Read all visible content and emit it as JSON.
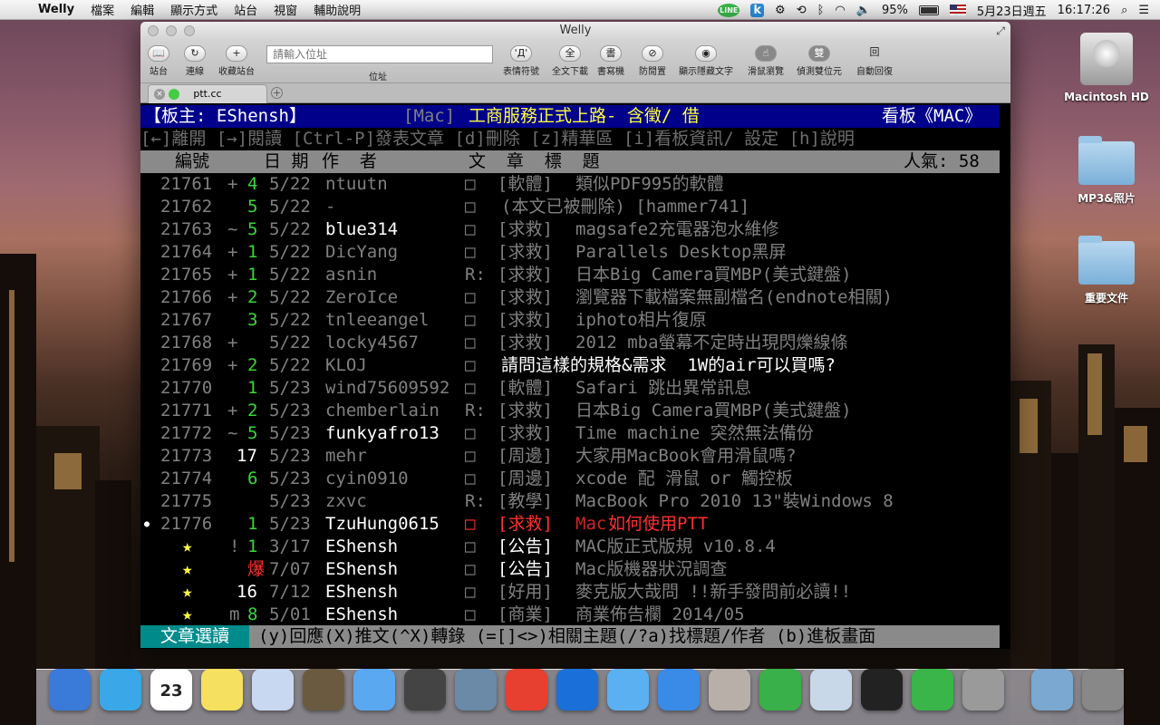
{
  "menubar": {
    "app": "Welly",
    "items": [
      "檔案",
      "編輯",
      "顯示方式",
      "站台",
      "視窗",
      "輔助說明"
    ],
    "battery": "95%",
    "date": "5月23日週五",
    "time": "16:17:26"
  },
  "desktop": {
    "icons": [
      "Macintosh HD",
      "MP3&照片",
      "重要文件"
    ]
  },
  "window": {
    "title": "Welly",
    "tab": "ptt.cc",
    "url_placeholder": "請輸入位址",
    "url_label": "位址",
    "toolbar": {
      "left": [
        {
          "glyph": "📖",
          "label": "站台"
        },
        {
          "glyph": "↻",
          "label": "連線"
        },
        {
          "glyph": "+",
          "label": "收藏站台"
        }
      ],
      "right": [
        {
          "glyph": "'Д'",
          "label": "表情符號"
        },
        {
          "glyph": "全",
          "label": "全文下載"
        },
        {
          "glyph": "書",
          "label": "書寫機"
        },
        {
          "glyph": "⊘",
          "label": "防閒置"
        },
        {
          "glyph": "◉",
          "label": "顯示隱藏文字"
        },
        {
          "glyph": "☝",
          "label": "滑鼠瀏覽"
        },
        {
          "glyph": "雙",
          "label": "偵測雙位元"
        },
        {
          "glyph": "回",
          "label": "自動回復"
        }
      ]
    }
  },
  "board": {
    "header_left": "【板主: EShensh】",
    "header_board": "[Mac]",
    "header_title": "工商服務正式上路- 含徵/ 借",
    "header_right": "看板《MAC》",
    "help": "[←]離開 [→]閱讀 [Ctrl-P]發表文章 [d]刪除 [z]精華區 [i]看板資訊/ 設定 [h]說明",
    "columns": {
      "num": "編號",
      "date": "日 期",
      "author": "作  者",
      "title": "文  章  標  題",
      "popularity": "人氣: 58"
    },
    "posts": [
      {
        "num": "21761",
        "mark": "+",
        "push": "4",
        "date": "5/22",
        "author": "ntuutn",
        "box": "□",
        "cat": "[軟體]",
        "title": "類似PDF995的軟體"
      },
      {
        "num": "21762",
        "mark": "",
        "push": "5",
        "date": "5/22",
        "author": "-",
        "box": "□",
        "cat": "",
        "title": "(本文已被刪除) [hammer741]"
      },
      {
        "num": "21763",
        "mark": "~",
        "push": "5",
        "date": "5/22",
        "author": "blue314",
        "box": "□",
        "cat": "[求救]",
        "title": "magsafe2充電器泡水維修"
      },
      {
        "num": "21764",
        "mark": "+",
        "push": "1",
        "date": "5/22",
        "author": "DicYang",
        "box": "□",
        "cat": "[求救]",
        "title": "Parallels Desktop黑屏"
      },
      {
        "num": "21765",
        "mark": "+",
        "push": "1",
        "date": "5/22",
        "author": "asnin",
        "box": "R:",
        "cat": "[求救]",
        "title": "日本Big Camera買MBP(美式鍵盤)"
      },
      {
        "num": "21766",
        "mark": "+",
        "push": "2",
        "date": "5/22",
        "author": "ZeroIce",
        "box": "□",
        "cat": "[求救]",
        "title": "瀏覽器下載檔案無副檔名(endnote相關)"
      },
      {
        "num": "21767",
        "mark": "",
        "push": "3",
        "date": "5/22",
        "author": "tnleeangel",
        "box": "□",
        "cat": "[求救]",
        "title": "iphoto相片復原"
      },
      {
        "num": "21768",
        "mark": "+",
        "push": "",
        "date": "5/22",
        "author": "locky4567",
        "box": "□",
        "cat": "[求救]",
        "title": "2012 mba螢幕不定時出現閃爍線條"
      },
      {
        "num": "21769",
        "mark": "+",
        "push": "2",
        "date": "5/22",
        "author": "KLOJ",
        "box": "□",
        "cat": "",
        "title": "請問這樣的規格&需求  1W的air可以買嗎?"
      },
      {
        "num": "21770",
        "mark": "",
        "push": "1",
        "date": "5/23",
        "author": "wind75609592",
        "box": "□",
        "cat": "[軟體]",
        "title": "Safari 跳出異常訊息"
      },
      {
        "num": "21771",
        "mark": "+",
        "push": "2",
        "date": "5/23",
        "author": "chemberlain",
        "box": "R:",
        "cat": "[求救]",
        "title": "日本Big Camera買MBP(美式鍵盤)"
      },
      {
        "num": "21772",
        "mark": "~",
        "push": "5",
        "date": "5/23",
        "author": "funkyafro13",
        "box": "□",
        "cat": "[求救]",
        "title": "Time machine 突然無法備份"
      },
      {
        "num": "21773",
        "mark": "",
        "push": "17",
        "date": "5/23",
        "author": "mehr",
        "box": "□",
        "cat": "[周邊]",
        "title": "大家用MacBook會用滑鼠嗎?"
      },
      {
        "num": "21774",
        "mark": "",
        "push": "6",
        "date": "5/23",
        "author": "cyin0910",
        "box": "□",
        "cat": "[周邊]",
        "title": "xcode 配 滑鼠 or 觸控板"
      },
      {
        "num": "21775",
        "mark": "",
        "push": "",
        "date": "5/23",
        "author": "zxvc",
        "box": "R:",
        "cat": "[教學]",
        "title": "MacBook Pro 2010 13\"裝Windows 8"
      },
      {
        "num": "21776",
        "mark": "",
        "push": "1",
        "date": "5/23",
        "author": "TzuHung0615",
        "box": "□",
        "cat": "[求救]",
        "title_pre": "Mac",
        "title": "如何使用PTT"
      },
      {
        "num": "★",
        "mark": "!",
        "push": "1",
        "date": "3/17",
        "author": "EShensh",
        "box": "□",
        "cat": "[公告]",
        "title": "MAC版正式版規 v10.8.4"
      },
      {
        "num": "★",
        "mark": "",
        "push": "爆",
        "date": "7/07",
        "author": "EShensh",
        "box": "□",
        "cat": "[公告]",
        "title": "Mac版機器狀況調查"
      },
      {
        "num": "★",
        "mark": "",
        "push": "16",
        "date": "7/12",
        "author": "EShensh",
        "box": "□",
        "cat": "[好用]",
        "title": "麥克版大哉問 !!新手發問前必讀!!"
      },
      {
        "num": "★",
        "mark": "m",
        "push": "8",
        "date": "5/01",
        "author": "EShensh",
        "box": "□",
        "cat": "[商業]",
        "title": "商業佈告欄 2014/05"
      }
    ],
    "footer_mode": "文章選讀",
    "footer_keys": "(y)回應(X)推文(^X)轉錄 (=[]<>)相關主題(/?a)找標題/作者 (b)進板畫面"
  },
  "dock": {
    "apps": [
      "Finder",
      "Safari",
      "Calendar",
      "Stickies",
      "Preview",
      "Mail",
      "Messages",
      "FaceTime",
      "iPhoto",
      "Chrome",
      "Word",
      "iTunes",
      "App Store",
      "Kindle",
      "Evernote",
      "Xcode",
      "QQ",
      "LINE",
      "System Preferences",
      "Downloads",
      "Trash"
    ],
    "calendar_day": "23"
  }
}
